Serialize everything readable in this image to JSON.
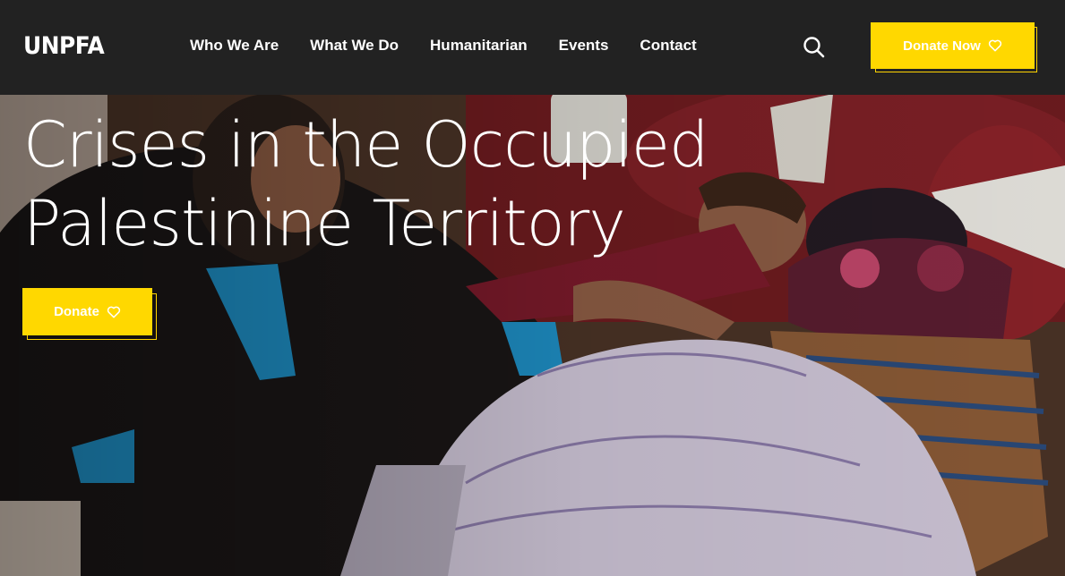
{
  "header": {
    "logo": "UNPFA",
    "nav": [
      {
        "label": "Who We Are"
      },
      {
        "label": "What We Do"
      },
      {
        "label": "Humanitarian"
      },
      {
        "label": "Events"
      },
      {
        "label": "Contact"
      }
    ],
    "search_icon": "search-icon",
    "donate_now_label": "Donate Now",
    "donate_now_icon": "heart-icon"
  },
  "hero": {
    "title": "Crises in the Occupied Palestinine Territory",
    "donate_label": "Donate",
    "donate_icon": "heart-icon"
  },
  "colors": {
    "header_bg": "#222222",
    "accent": "#ffd800",
    "text": "#ffffff"
  }
}
